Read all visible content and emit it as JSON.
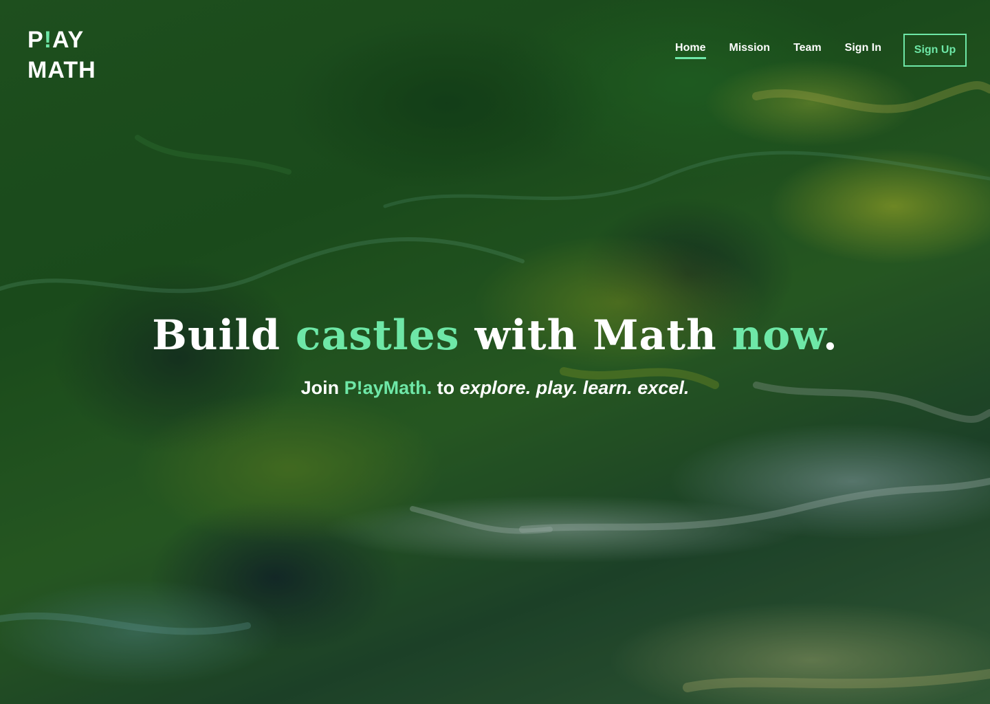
{
  "brand": {
    "logo_line1_pre": "P",
    "logo_line1_bang": "!",
    "logo_line1_post": "AY",
    "logo_line2": "MATH",
    "accent_color": "#6ee7a7"
  },
  "nav": {
    "items": [
      {
        "label": "Home",
        "active": true
      },
      {
        "label": "Mission",
        "active": false
      },
      {
        "label": "Team",
        "active": false
      },
      {
        "label": "Sign In",
        "active": false
      }
    ],
    "signup_label": "Sign Up"
  },
  "hero": {
    "headline": {
      "part1": "Build",
      "part2": "castles",
      "part3": "with Math",
      "part4": "now",
      "part5": "."
    },
    "subline": {
      "join": "Join",
      "brand": "P!ayMath.",
      "to": "to",
      "verbs": [
        "explore.",
        "play.",
        "learn.",
        "excel."
      ]
    }
  }
}
